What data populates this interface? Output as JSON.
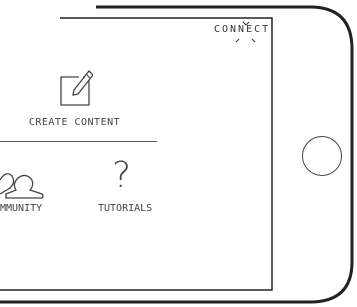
{
  "app": {
    "brand": "CONNECT"
  },
  "menu": {
    "create": {
      "label": "CREATE CONTENT",
      "icon": "edit-icon"
    },
    "community": {
      "label": "MMUNITY",
      "icon": "community-icon"
    },
    "tutorials": {
      "label": "TUTORIALS",
      "icon": "question-icon",
      "glyph": "?"
    }
  },
  "device": {
    "home_button": "home-button"
  }
}
